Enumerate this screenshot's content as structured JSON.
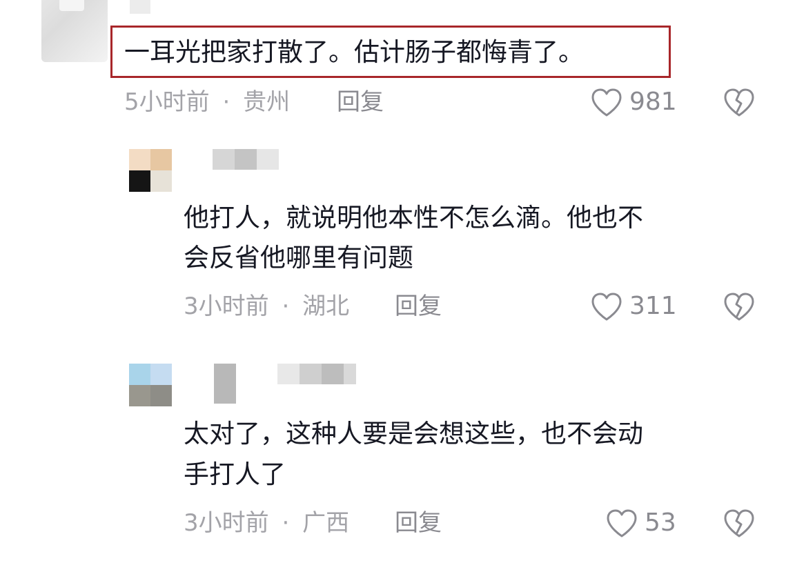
{
  "comments": [
    {
      "text": "一耳光把家打散了。估计肠子都悔青了。",
      "time": "5小时前",
      "separator": "·",
      "location": "贵州",
      "reply_label": "回复",
      "likes": "981"
    },
    {
      "text_line1": "他打人，就说明他本性不怎么滴。他也不",
      "text_line2": "会反省他哪里有问题",
      "time": "3小时前",
      "separator": "·",
      "location": "湖北",
      "reply_label": "回复",
      "likes": "311",
      "avatar_colors": [
        "#f3dcc4",
        "#e7c7a2",
        "#151515",
        "#e7e2d8"
      ]
    },
    {
      "text_line1": "太对了，这种人要是会想这些，也不会动",
      "text_line2": "手打人了",
      "time": "3小时前",
      "separator": "·",
      "location": "广西",
      "reply_label": "回复",
      "likes": "53",
      "avatar_colors": [
        "#a9d4ea",
        "#c5dcf1",
        "#99978e",
        "#8e8d87"
      ]
    }
  ],
  "colors": {
    "highlight_border": "#a8262a",
    "meta_text": "#a3a3a8",
    "body_text": "#161823"
  },
  "icons": {
    "like": "heart-outline-icon",
    "dislike": "broken-heart-icon"
  }
}
